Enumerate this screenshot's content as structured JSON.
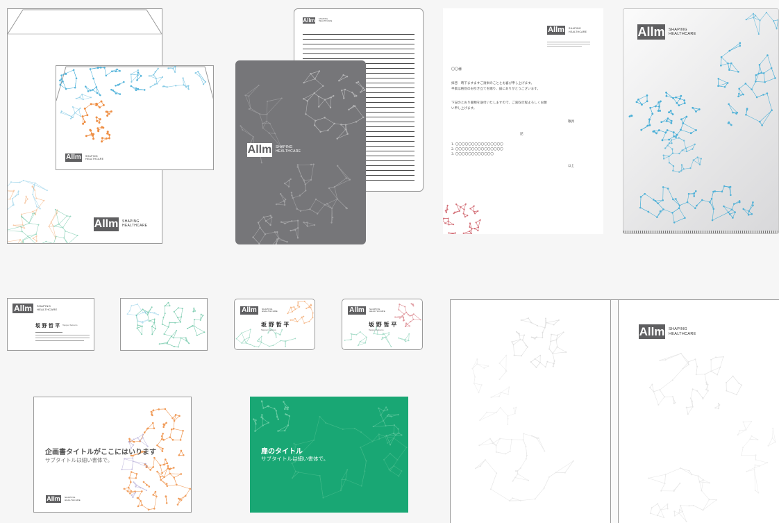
{
  "brand": {
    "name": "Allm",
    "tagline_1": "SHAPING",
    "tagline_2": "HEALTHCARE",
    "colors": {
      "logo_gray": "#5f5f61",
      "network_blue": "#3aa9d5",
      "network_orange": "#ee8a3c",
      "network_green": "#1fa877",
      "network_red": "#c0303c",
      "cover_green": "#19a774",
      "folder_gray": "#767679"
    }
  },
  "letter": {
    "salutation": "〇〇様",
    "body_1": "拝啓　時下ますますご清栄のこととお喜び申し上げます。",
    "body_2": "平素は格別のお引き立てを賜り、誠にありがとうございます。",
    "body_3": "下記のとおり書類を送付いたしますので、ご査収の程よろしくお願",
    "body_4": "い申し上げます。",
    "closing": "敬具",
    "ki": "記",
    "item_1": "1. 〇〇〇〇〇〇〇〇〇〇〇〇〇〇〇",
    "item_2": "2. 〇〇〇〇〇〇〇〇〇〇〇〇〇〇〇",
    "item_3": "3. 〇〇〇〇〇〇〇〇〇〇〇〇",
    "ijo": "以上"
  },
  "business_card": {
    "name": "坂 野 哲 平",
    "name_romaji": "Teppei Sakano"
  },
  "proposal_cover": {
    "title": "企画書タイトルがここにはいります",
    "subtitle": "サブタイトルは細い書体で。"
  },
  "door_cover": {
    "title": "扉のタイトル",
    "subtitle": "サブタイトルは細い書体で。"
  }
}
